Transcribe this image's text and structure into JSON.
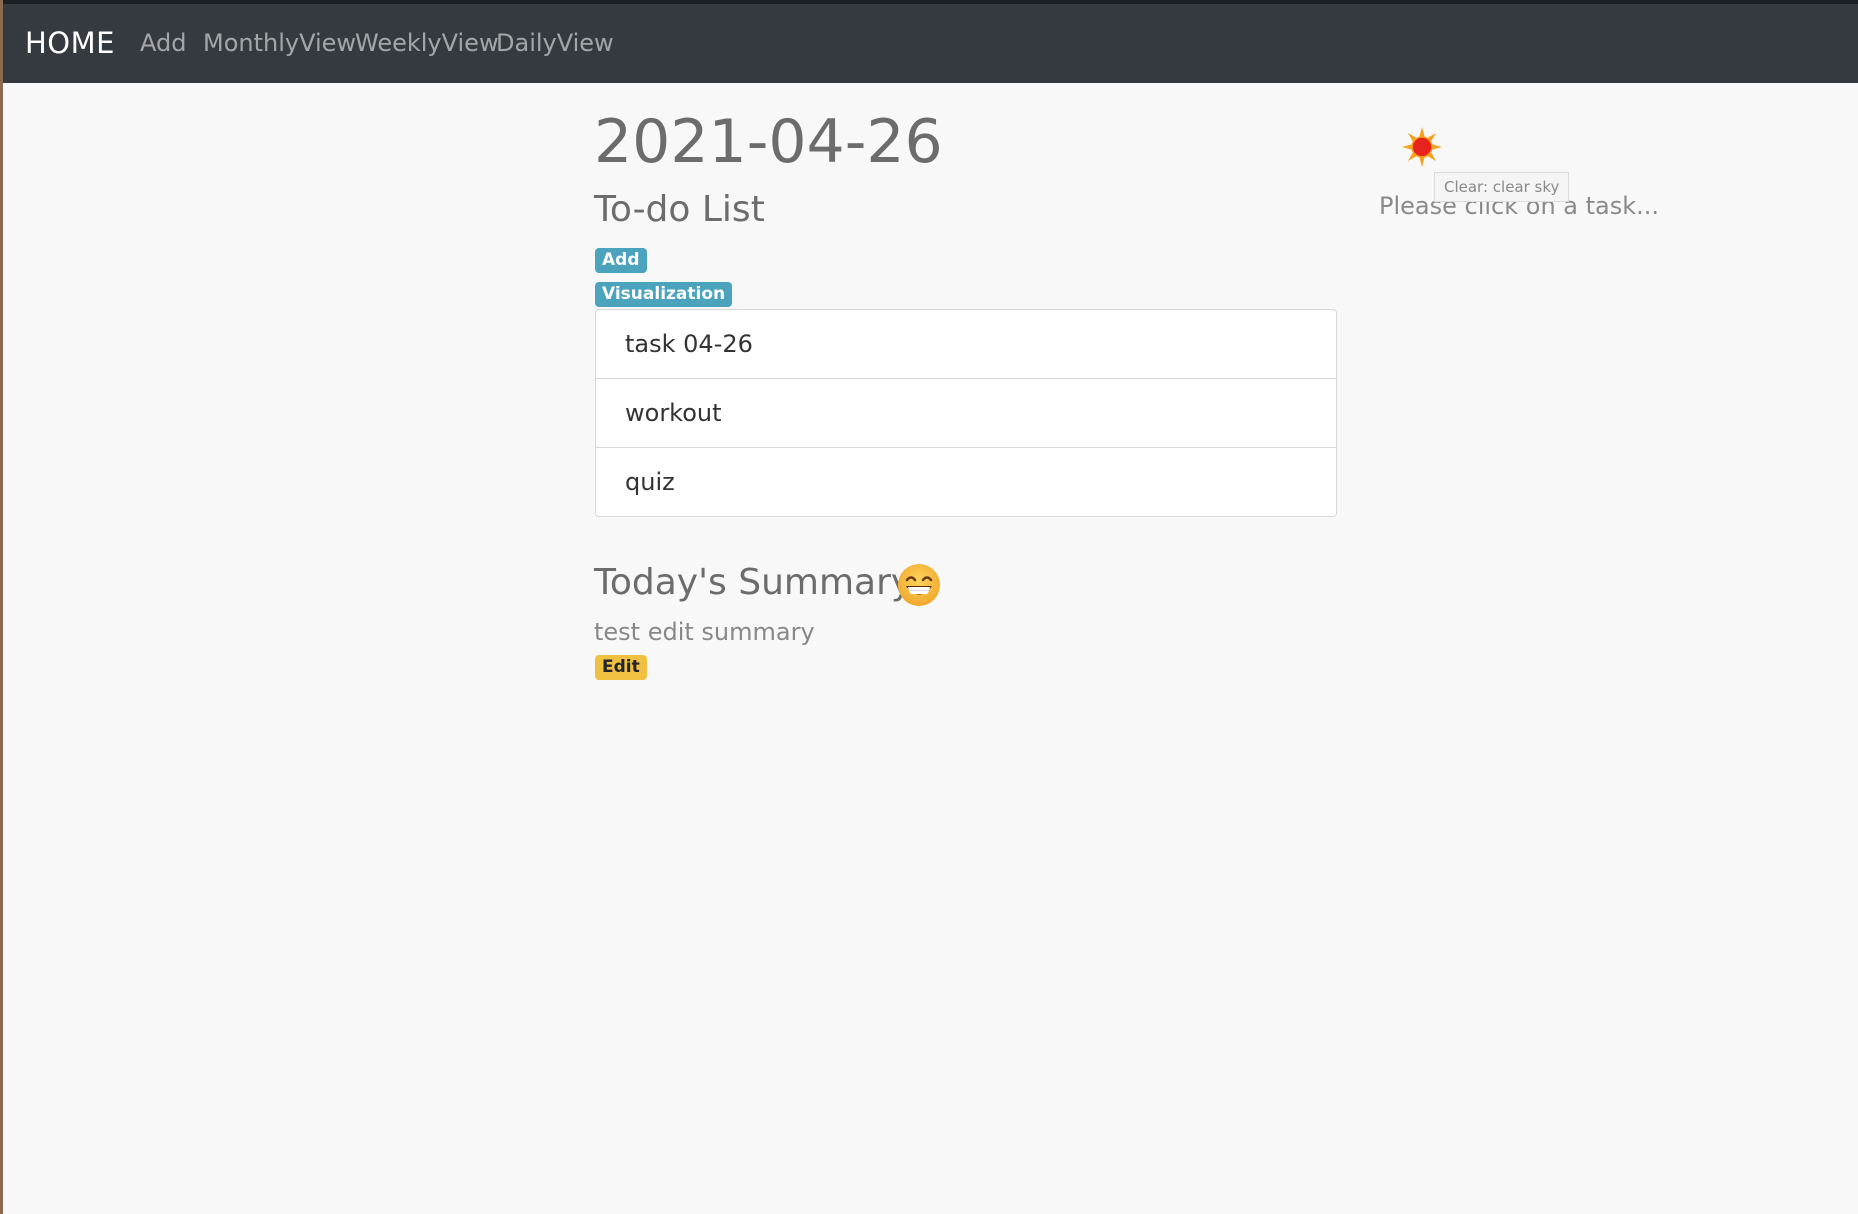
{
  "nav": {
    "brand": "HOME",
    "links": [
      "Add",
      "MonthlyView",
      "WeeklyView",
      "DailyView"
    ]
  },
  "main": {
    "date": "2021-04-26",
    "todo_heading": "To-do List",
    "add_label": "Add",
    "visualization_label": "Visualization",
    "tasks": [
      "task 04-26",
      "workout",
      "quiz"
    ],
    "summary_heading": "Today's Summary",
    "summary_text": "test edit summary",
    "edit_label": "Edit",
    "mood_icon": "grinning-face-icon"
  },
  "weather": {
    "icon": "sun-icon",
    "tooltip": "Clear: clear sky",
    "prompt": "Please click on a task..."
  },
  "colors": {
    "navbar": "#343a40",
    "info_badge": "#4ba3bd",
    "warning_badge": "#f0c040",
    "background": "#f8f8f8"
  }
}
